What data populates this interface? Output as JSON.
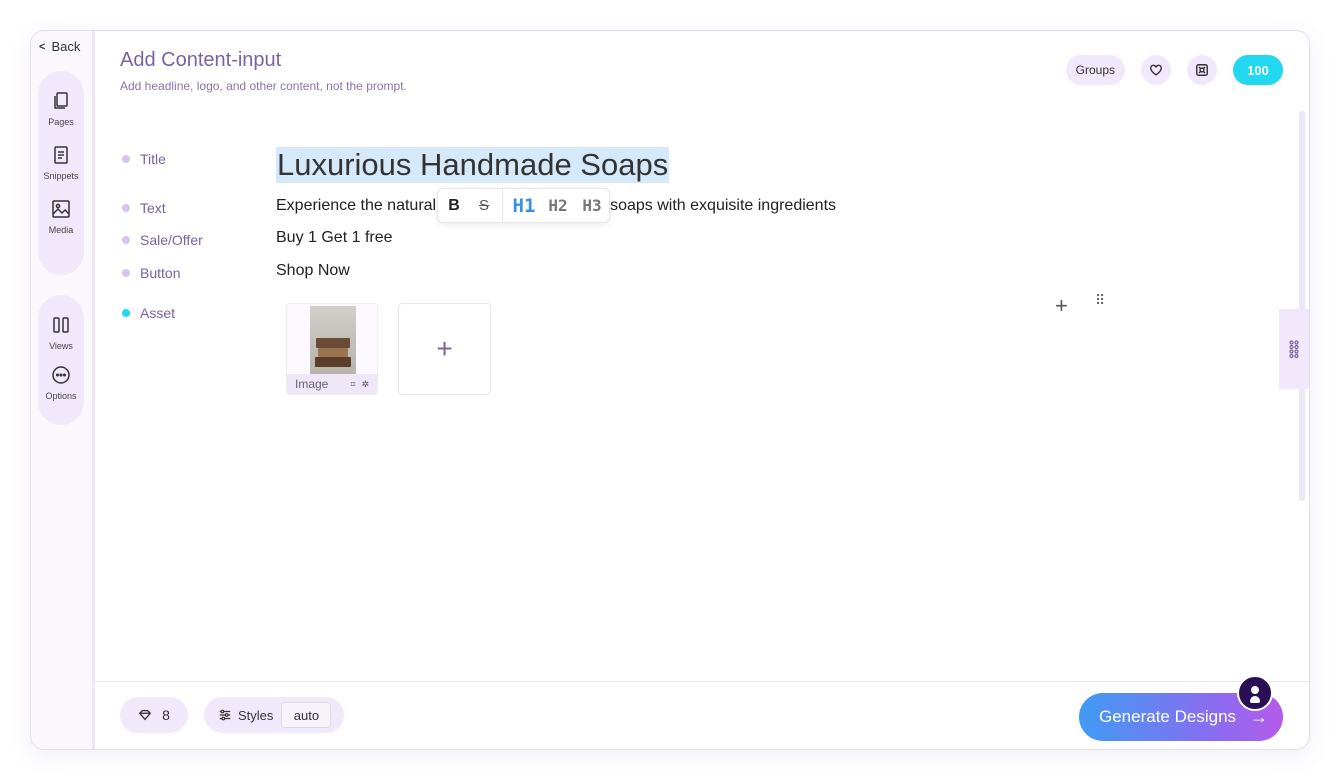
{
  "sidebar": {
    "back_label": "Back",
    "group1": [
      {
        "label": "Pages",
        "icon": "pages-icon"
      },
      {
        "label": "Snippets",
        "icon": "snippets-icon"
      },
      {
        "label": "Media",
        "icon": "media-icon"
      }
    ],
    "group2": [
      {
        "label": "Views",
        "icon": "views-icon"
      },
      {
        "label": "Options",
        "icon": "options-icon"
      }
    ]
  },
  "header": {
    "title": "Add Content-input",
    "subtitle": "Add headline, logo, and other content, not the prompt.",
    "groups_label": "Groups",
    "credits": "100"
  },
  "fields": {
    "title_label": "Title",
    "title_value": "Luxurious Handmade Soaps",
    "text_label": "Text",
    "text_value_start": "Experience the natural",
    "text_value_end": "soaps with exquisite ingredients",
    "sale_label": "Sale/Offer",
    "sale_value": "Buy 1 Get 1 free",
    "button_label": "Button",
    "button_value": "Shop Now",
    "asset_label": "Asset"
  },
  "toolbar": {
    "bold": "B",
    "strike": "S",
    "h1": "H1",
    "h2": "H2",
    "h3": "H3"
  },
  "asset": {
    "card_label": "Image",
    "add_symbol": "+"
  },
  "row_actions": {
    "add": "+",
    "drag": "⠿"
  },
  "footer": {
    "gems": "8",
    "styles_label": "Styles",
    "styles_value": "auto",
    "generate_label": "Generate Designs",
    "generate_arrow": "→"
  },
  "colors": {
    "accent_purple": "#7b62a3",
    "pill_bg": "#f1e9fb",
    "credits_cyan": "#22d8ee",
    "selection_blue": "#d5e9fb",
    "h1_active": "#3b8fe0"
  }
}
